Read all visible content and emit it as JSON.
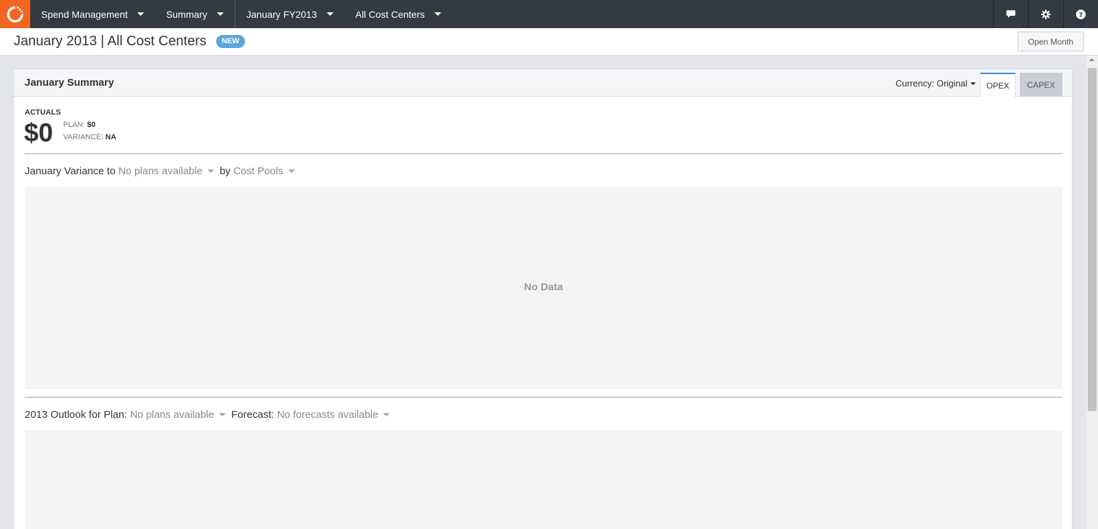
{
  "nav": {
    "items": [
      {
        "label": "Spend Management"
      },
      {
        "label": "Summary"
      },
      {
        "label": "January FY2013"
      },
      {
        "label": "All Cost Centers"
      }
    ],
    "icons": [
      "chat-icon",
      "gear-icon",
      "help-icon"
    ]
  },
  "header": {
    "title": "January 2013 | All Cost Centers",
    "badge": "NEW",
    "open_month_label": "Open Month"
  },
  "panel": {
    "title": "January Summary",
    "currency_label": "Currency: Original",
    "tabs": [
      {
        "label": "OPEX",
        "active": true
      },
      {
        "label": "CAPEX",
        "active": false
      }
    ],
    "actuals_label": "ACTUALS",
    "actuals_value": "$0",
    "plan_label": "PLAN:",
    "plan_value": "$0",
    "variance_label": "VARIANCE:",
    "variance_value": "NA"
  },
  "variance_section": {
    "prefix": "January Variance to",
    "plan_select": "No plans available",
    "by_label": "by",
    "group_select": "Cost Pools",
    "empty_text": "No Data"
  },
  "outlook_section": {
    "prefix": "2013 Outlook for Plan:",
    "plan_select": "No plans available",
    "forecast_label": "Forecast:",
    "forecast_select": "No forecasts available"
  },
  "colors": {
    "nav_bg": "#343a42",
    "brand": "#f26522",
    "badge": "#5aa6dc",
    "active_tab_border": "#3c8dce"
  }
}
